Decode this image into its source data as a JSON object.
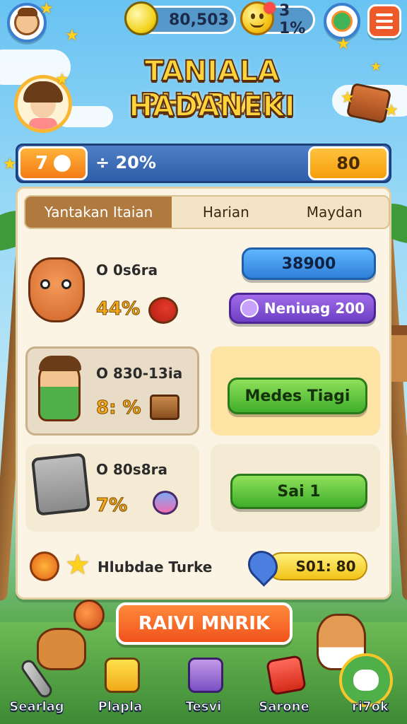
{
  "topbar": {
    "profile_icon": "explorer-avatar-icon",
    "gems_value": "80,503",
    "coins_value": "3 1%",
    "quest_icon": "chameleon-icon",
    "menu_icon": "hamburger-icon"
  },
  "title": {
    "line1": "TANIALA PHARIAN",
    "line2": "HADANEKI"
  },
  "level": {
    "badge_value": "7",
    "progress_text": "÷ 20%",
    "score_value": "80"
  },
  "tabs": [
    {
      "label": "Yantakan Itaian",
      "active": true
    },
    {
      "label": "Harian",
      "active": false
    },
    {
      "label": "Maydan",
      "active": false
    }
  ],
  "rows": [
    {
      "name": "O 0s6ra",
      "stat": "44%",
      "button_top": "38900",
      "button_bottom": "Neniuag 200"
    },
    {
      "name": "O 830-13ia",
      "stat": "8: %",
      "button": "Medes Tiagi"
    },
    {
      "name": "O 80s8ra",
      "stat": "7%",
      "button": "Sai 1"
    }
  ],
  "bonus": {
    "label": "Hlubdae Turke",
    "value": "S01: 80"
  },
  "primary_button": "RAIVI MNRIK",
  "nav": [
    {
      "label": "Searlag",
      "icon": "sword-icon"
    },
    {
      "label": "Plapla",
      "icon": "trophy-box-icon"
    },
    {
      "label": "Tesvi",
      "icon": "cash-register-icon"
    },
    {
      "label": "Sarone",
      "icon": "shop-tag-icon"
    },
    {
      "label": "ri7ok",
      "icon": "chat-bubble-icon"
    }
  ],
  "colors": {
    "accent_orange": "#f0521b",
    "accent_green": "#3fae2b",
    "accent_blue": "#2f7fd8",
    "accent_purple": "#6c3fc4",
    "panel": "#fbf4e4"
  }
}
